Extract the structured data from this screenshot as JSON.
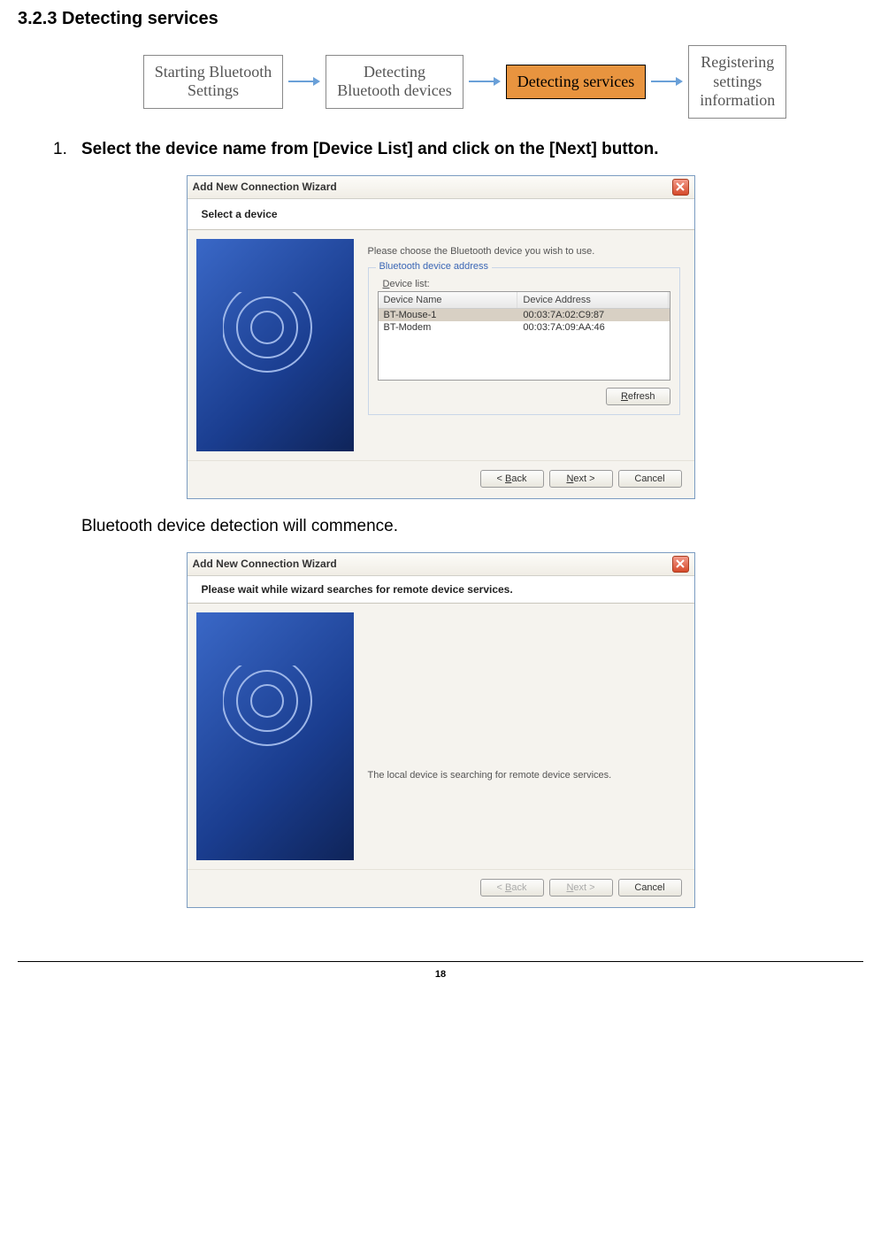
{
  "heading": "3.2.3    Detecting services",
  "flow": {
    "steps": [
      "Starting Bluetooth\nSettings",
      "Detecting\nBluetooth devices",
      "Detecting services",
      "Registering\nsettings\ninformation"
    ],
    "active_index": 2
  },
  "step1": {
    "num": "1.",
    "text": "Select the device name from [Device List] and click on the [Next] button."
  },
  "dialog1": {
    "title": "Add New Connection Wizard",
    "banner": "Select a device",
    "prompt": "Please choose the Bluetooth device you wish to use.",
    "fieldset_legend": "Bluetooth device address",
    "device_label": "Device list:",
    "cols": {
      "name": "Device Name",
      "addr": "Device Address"
    },
    "rows": [
      {
        "name": "BT-Mouse-1",
        "addr": "00:03:7A:02:C9:87",
        "selected": true
      },
      {
        "name": "BT-Modem",
        "addr": "00:03:7A:09:AA:46",
        "selected": false
      }
    ],
    "refresh": "Refresh",
    "back": "< Back",
    "next": "Next >",
    "cancel": "Cancel"
  },
  "caption2": "Bluetooth device detection will commence.",
  "dialog2": {
    "title": "Add New Connection Wizard",
    "banner": "Please wait while wizard searches for remote device services.",
    "message": "The local device is searching for remote device services.",
    "back": "< Back",
    "next": "Next >",
    "cancel": "Cancel"
  },
  "page_number": "18"
}
